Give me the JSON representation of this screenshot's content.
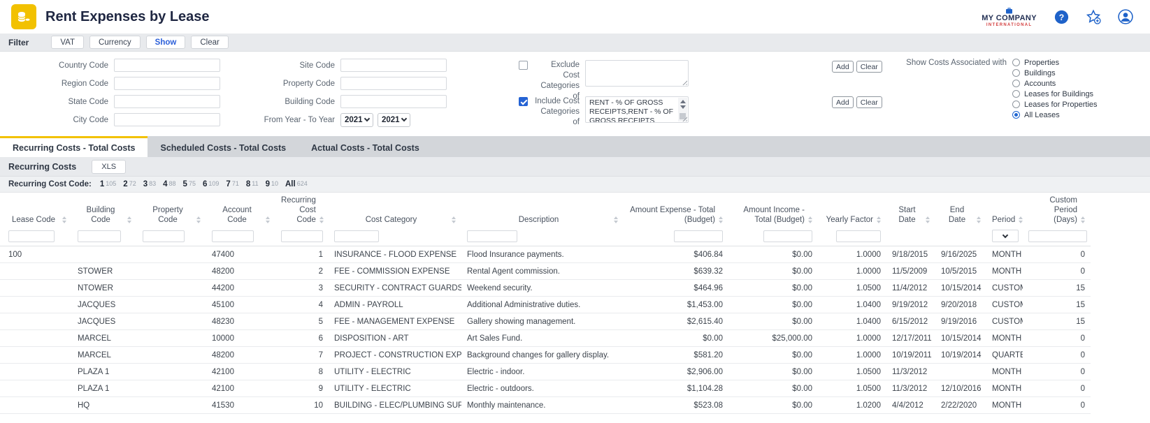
{
  "colors": {
    "accent_yellow": "#F2C100",
    "link_blue": "#2B5FD9",
    "selection_blue": "#2563D4",
    "brand_navy": "#233054",
    "brand_red": "#D23B3B"
  },
  "header": {
    "title": "Rent Expenses by Lease",
    "app_icon": "coins-icon",
    "brand_name": "MY COMPANY",
    "brand_subtitle": "INTERNATIONAL",
    "action_icons": [
      "help-icon",
      "star-plus-icon",
      "user-icon"
    ]
  },
  "filter_toolbar": {
    "label": "Filter",
    "buttons": [
      {
        "label": "VAT",
        "accent": false
      },
      {
        "label": "Currency",
        "accent": false
      },
      {
        "label": "Show",
        "accent": true
      },
      {
        "label": "Clear",
        "accent": false
      }
    ]
  },
  "filter_panel": {
    "col1": [
      {
        "label": "Country Code",
        "value": ""
      },
      {
        "label": "Region Code",
        "value": ""
      },
      {
        "label": "State Code",
        "value": ""
      },
      {
        "label": "City Code",
        "value": ""
      }
    ],
    "col2": [
      {
        "label": "Site Code",
        "value": ""
      },
      {
        "label": "Property Code",
        "value": ""
      },
      {
        "label": "Building Code",
        "value": ""
      }
    ],
    "year_range": {
      "label": "From Year - To Year",
      "from": "2021",
      "to": "2021"
    },
    "exclude": {
      "label": "Exclude Cost Categories of",
      "checked": false,
      "value": ""
    },
    "include": {
      "label": "Include Cost Categories of",
      "checked": true,
      "value": "RENT - % OF GROSS RECEIPTS,RENT - % OF GROSS RECEIPTS"
    },
    "add_label": "Add",
    "clear_label": "Clear",
    "show_costs": {
      "label": "Show Costs Associated with",
      "options": [
        "Properties",
        "Buildings",
        "Accounts",
        "Leases for Buildings",
        "Leases for Properties",
        "All Leases"
      ],
      "selected": "All Leases"
    }
  },
  "tabs": [
    {
      "label": "Recurring Costs - Total Costs",
      "active": true
    },
    {
      "label": "Scheduled Costs - Total Costs",
      "active": false
    },
    {
      "label": "Actual Costs - Total Costs",
      "active": false
    }
  ],
  "section": {
    "title": "Recurring Costs",
    "xls": "XLS"
  },
  "pagination": {
    "label": "Recurring Cost Code:",
    "pages": [
      {
        "page": "1",
        "count": "105"
      },
      {
        "page": "2",
        "count": "72"
      },
      {
        "page": "3",
        "count": "83"
      },
      {
        "page": "4",
        "count": "88"
      },
      {
        "page": "5",
        "count": "75"
      },
      {
        "page": "6",
        "count": "109"
      },
      {
        "page": "7",
        "count": "71"
      },
      {
        "page": "8",
        "count": "11"
      },
      {
        "page": "9",
        "count": "10"
      },
      {
        "page": "All",
        "count": "624"
      }
    ]
  },
  "table": {
    "columns": [
      {
        "label": "Lease Code",
        "filter": "text"
      },
      {
        "label": "Building Code",
        "filter": "text"
      },
      {
        "label": "Property Code",
        "filter": "text"
      },
      {
        "label": "Account Code",
        "filter": "text"
      },
      {
        "label": "Recurring Cost Code",
        "filter": "text"
      },
      {
        "label": "Cost Category",
        "filter": "text"
      },
      {
        "label": "Description",
        "filter": "text"
      },
      {
        "label": "Amount Expense - Total (Budget)",
        "filter": "text"
      },
      {
        "label": "Amount Income - Total (Budget)",
        "filter": "text"
      },
      {
        "label": "Yearly Factor",
        "filter": "text"
      },
      {
        "label": "Start Date",
        "filter": "none"
      },
      {
        "label": "End Date",
        "filter": "none"
      },
      {
        "label": "Period",
        "filter": "select"
      },
      {
        "label": "Custom Period (Days)",
        "filter": "text"
      }
    ],
    "rows": [
      [
        "100",
        "",
        "",
        "47400",
        "1",
        "INSURANCE - FLOOD EXPENSE",
        "Flood Insurance payments.",
        "$406.84",
        "$0.00",
        "1.0000",
        "9/18/2015",
        "9/16/2025",
        "MONTH",
        "0"
      ],
      [
        "",
        "STOWER",
        "",
        "48200",
        "2",
        "FEE - COMMISSION EXPENSE",
        "Rental Agent commission.",
        "$639.32",
        "$0.00",
        "1.0000",
        "11/5/2009",
        "10/5/2015",
        "MONTH",
        "0"
      ],
      [
        "",
        "NTOWER",
        "",
        "44200",
        "3",
        "SECURITY - CONTRACT GUARDS",
        "Weekend security.",
        "$464.96",
        "$0.00",
        "1.0500",
        "11/4/2012",
        "10/15/2014",
        "CUSTOM",
        "15"
      ],
      [
        "",
        "JACQUES",
        "",
        "45100",
        "4",
        "ADMIN - PAYROLL",
        "Additional Administrative duties.",
        "$1,453.00",
        "$0.00",
        "1.0400",
        "9/19/2012",
        "9/20/2018",
        "CUSTOM",
        "15"
      ],
      [
        "",
        "JACQUES",
        "",
        "48230",
        "5",
        "FEE - MANAGEMENT EXPENSE",
        "Gallery showing management.",
        "$2,615.40",
        "$0.00",
        "1.0400",
        "6/15/2012",
        "9/19/2016",
        "CUSTOM",
        "15"
      ],
      [
        "",
        "MARCEL",
        "",
        "10000",
        "6",
        "DISPOSITION - ART",
        "Art Sales Fund.",
        "$0.00",
        "$25,000.00",
        "1.0000",
        "12/17/2011",
        "10/15/2014",
        "MONTH",
        "0"
      ],
      [
        "",
        "MARCEL",
        "",
        "48200",
        "7",
        "PROJECT - CONSTRUCTION EXPENSE",
        "Background changes for gallery display.",
        "$581.20",
        "$0.00",
        "1.0000",
        "10/19/2011",
        "10/19/2014",
        "QUARTER",
        "0"
      ],
      [
        "",
        "PLAZA 1",
        "",
        "42100",
        "8",
        "UTILITY - ELECTRIC",
        "Electric - indoor.",
        "$2,906.00",
        "$0.00",
        "1.0500",
        "11/3/2012",
        "",
        "MONTH",
        "0"
      ],
      [
        "",
        "PLAZA 1",
        "",
        "42100",
        "9",
        "UTILITY - ELECTRIC",
        "Electric - outdoors.",
        "$1,104.28",
        "$0.00",
        "1.0500",
        "11/3/2012",
        "12/10/2016",
        "MONTH",
        "0"
      ],
      [
        "",
        "HQ",
        "",
        "41530",
        "10",
        "BUILDING - ELEC/PLUMBING SUPPLIE",
        "Monthly maintenance.",
        "$523.08",
        "$0.00",
        "1.0200",
        "4/4/2012",
        "2/22/2020",
        "MONTH",
        "0"
      ]
    ]
  }
}
